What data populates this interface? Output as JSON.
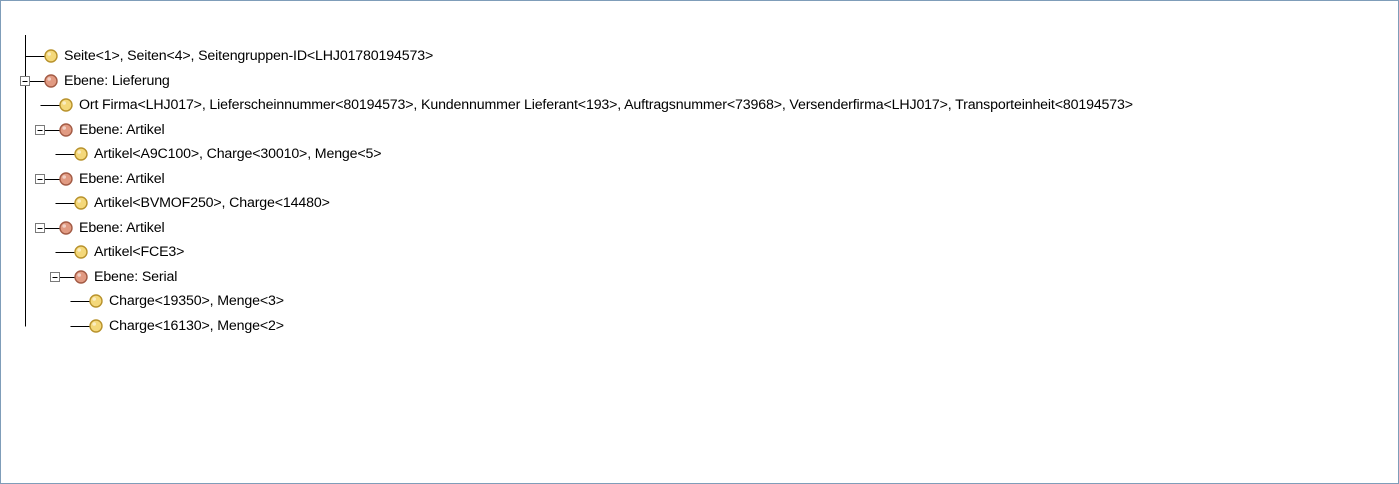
{
  "tree": {
    "nodes": [
      {
        "label": "Seite<1>, Seiten<4>, Seitengruppen-ID<LHJ01780194573>",
        "type": "data",
        "depth": 0,
        "expandable": false
      },
      {
        "label": "Ebene: Lieferung",
        "type": "level",
        "depth": 0,
        "expandable": true,
        "expanded": true
      },
      {
        "label": "Ort Firma<LHJ017>, Lieferscheinnummer<80194573>, Kundennummer Lieferant<193>, Auftragsnummer<73968>, Versenderfirma<LHJ017>, Transporteinheit<80194573>",
        "type": "data",
        "depth": 1,
        "expandable": false
      },
      {
        "label": "Ebene: Artikel",
        "type": "level",
        "depth": 1,
        "expandable": true,
        "expanded": true
      },
      {
        "label": "Artikel<A9C100>, Charge<30010>, Menge<5>",
        "type": "data",
        "depth": 2,
        "expandable": false
      },
      {
        "label": "Ebene: Artikel",
        "type": "level",
        "depth": 1,
        "expandable": true,
        "expanded": true
      },
      {
        "label": "Artikel<BVMOF250>, Charge<14480>",
        "type": "data",
        "depth": 2,
        "expandable": false
      },
      {
        "label": "Ebene: Artikel",
        "type": "level",
        "depth": 1,
        "expandable": true,
        "expanded": true
      },
      {
        "label": "Artikel<FCE3>",
        "type": "data",
        "depth": 2,
        "expandable": false
      },
      {
        "label": "Ebene: Serial",
        "type": "level",
        "depth": 2,
        "expandable": true,
        "expanded": true
      },
      {
        "label": "Charge<19350>, Menge<3>",
        "type": "data",
        "depth": 3,
        "expandable": false
      },
      {
        "label": "Charge<16130>, Menge<2>",
        "type": "data",
        "depth": 3,
        "expandable": false
      }
    ],
    "icons": {
      "data": "yellow-circle-icon",
      "level": "red-circle-icon",
      "expanded": "collapse-box-icon"
    },
    "colors": {
      "data_fill": "#f4d87a",
      "data_stroke": "#b8922c",
      "level_fill": "#e19a82",
      "level_stroke": "#a35b45",
      "line": "#000000",
      "border": "#7f9db9"
    }
  }
}
